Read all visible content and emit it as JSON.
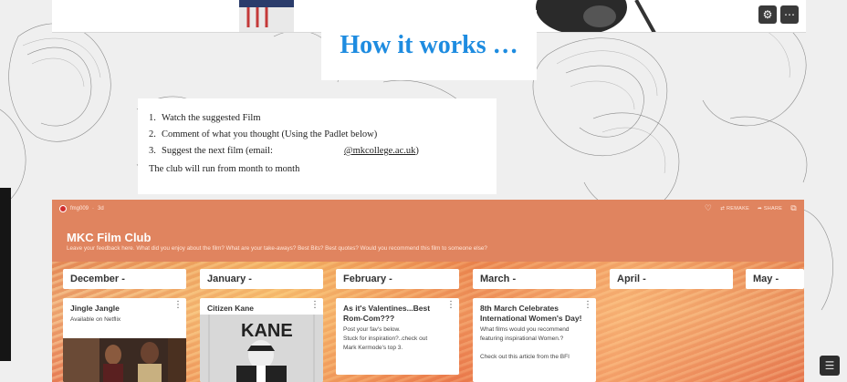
{
  "slide": {
    "title": "How it works …",
    "steps": [
      {
        "num": "1.",
        "text": "Watch the suggested Film"
      },
      {
        "num": "2.",
        "text": "Comment of what you thought (Using the Padlet below)"
      },
      {
        "num": "3.",
        "text": "Suggest the next film (email:",
        "email": "@mkcollege.ac.uk",
        "close": ")"
      }
    ],
    "footer": "The club will run from month to month"
  },
  "controls": {
    "settings_icon": "gear-icon",
    "more_icon": "more-icon",
    "fullscreen_icon": "fullscreen-icon"
  },
  "padlet": {
    "background_color": "#e0845f",
    "author": "fmg009",
    "age": "3d",
    "actions": {
      "remake": "REMAKE",
      "share": "SHARE"
    },
    "title": "MKC Film Club",
    "description": "Leave your feedback here. What did you enjoy about the film? What are your take-aways? Best Bits? Best quotes? Would you recommend this film to someone else?",
    "columns": [
      {
        "label": "December -"
      },
      {
        "label": "January -"
      },
      {
        "label": "February -"
      },
      {
        "label": "March -"
      },
      {
        "label": "April -"
      },
      {
        "label": "May -"
      }
    ],
    "cards": [
      {
        "title": "Jingle Jangle",
        "body": [
          "Available on Netflix"
        ]
      },
      {
        "title": "Citizen Kane",
        "body": [],
        "poster_text": "KANE"
      },
      {
        "title": "As it's Valentines...Best Rom-Com???",
        "body": [
          "Post your fav's below.",
          "Stuck for inspiration?..check out",
          "Mark Kermode's top 3."
        ]
      },
      {
        "title": "8th March Celebrates International Women's Day!",
        "body": [
          "What films would you recommend",
          "featuring inspirational Women.?",
          "",
          "Check out this article from the BFI"
        ]
      }
    ]
  }
}
